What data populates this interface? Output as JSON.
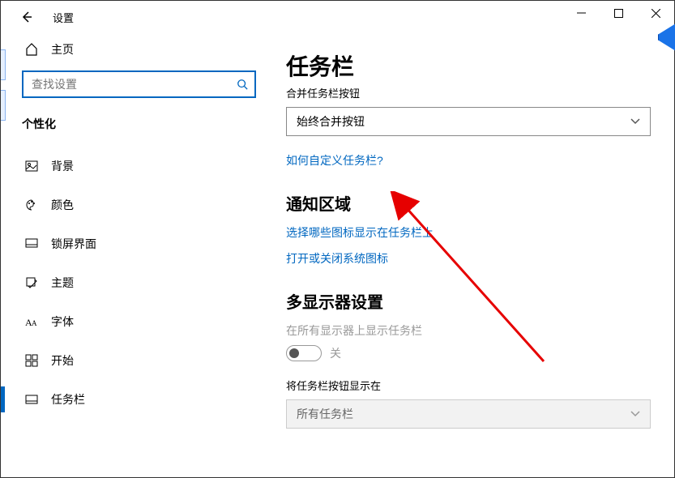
{
  "titlebar": {
    "app_title": "设置"
  },
  "sidebar": {
    "home_label": "主页",
    "search_placeholder": "查找设置",
    "category_label": "个性化",
    "items": [
      {
        "label": "背景"
      },
      {
        "label": "颜色"
      },
      {
        "label": "锁屏界面"
      },
      {
        "label": "主题"
      },
      {
        "label": "字体"
      },
      {
        "label": "开始"
      },
      {
        "label": "任务栏"
      }
    ]
  },
  "main": {
    "title": "任务栏",
    "combine_label": "合并任务栏按钮",
    "combine_value": "始终合并按钮",
    "customize_link": "如何自定义任务栏?",
    "notification_heading": "通知区域",
    "select_icons_link": "选择哪些图标显示在任务栏上",
    "system_icons_link": "打开或关闭系统图标",
    "multi_monitor_heading": "多显示器设置",
    "show_all_label": "在所有显示器上显示任务栏",
    "toggle_off": "关",
    "show_buttons_on_label": "将任务栏按钮显示在",
    "show_buttons_value": "所有任务栏"
  }
}
